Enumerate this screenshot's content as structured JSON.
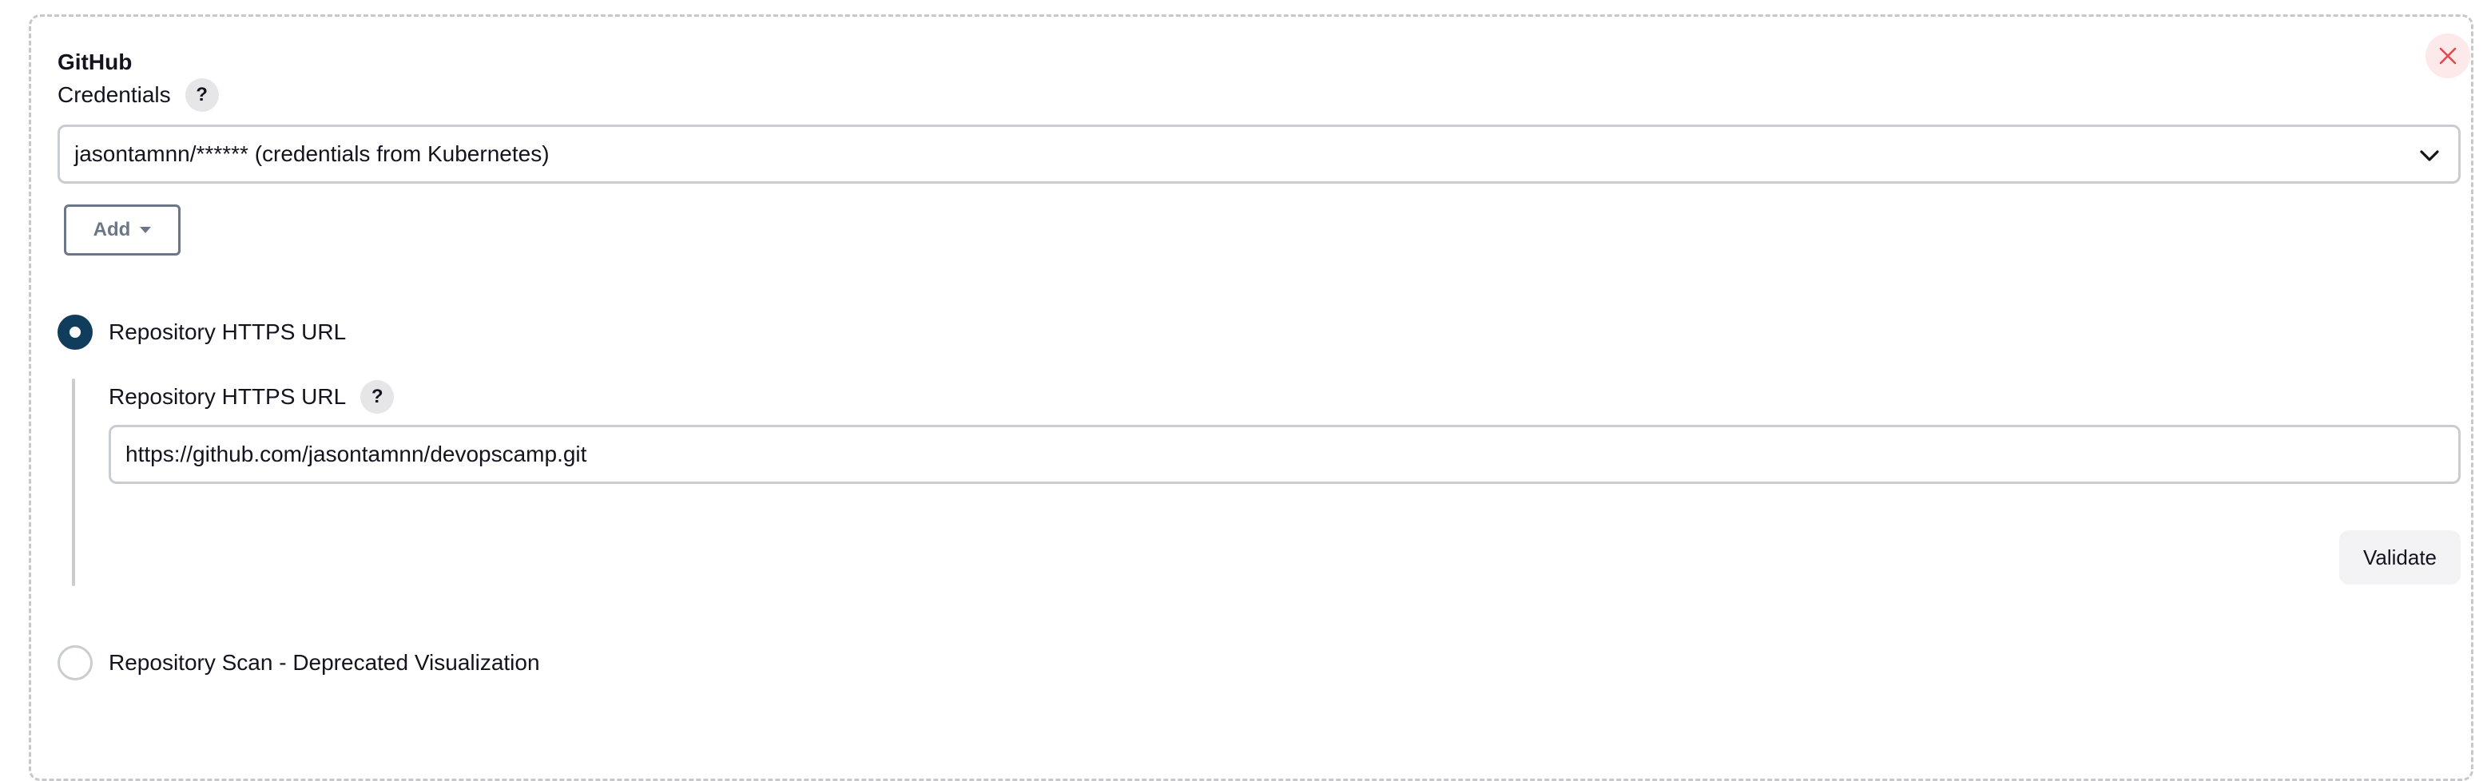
{
  "section": {
    "title": "GitHub"
  },
  "credentials": {
    "label": "Credentials",
    "help": "?",
    "selected_value": "jasontamnn/****** (credentials from Kubernetes)",
    "add_label": "Add"
  },
  "repo_options": [
    {
      "label": "Repository HTTPS URL",
      "selected": true
    },
    {
      "label": "Repository Scan - Deprecated Visualization",
      "selected": false
    }
  ],
  "https_url": {
    "label": "Repository HTTPS URL",
    "help": "?",
    "value": "https://github.com/jasontamnn/devopscamp.git",
    "validate_label": "Validate"
  },
  "colors": {
    "radio_checked": "#113d5c",
    "close_icon": "#e5484d",
    "close_bg": "#fde8ea"
  },
  "icons": {
    "close": "close-icon",
    "dropdown": "chevron-down-icon",
    "caret": "caret-down-icon",
    "help": "help-icon"
  }
}
